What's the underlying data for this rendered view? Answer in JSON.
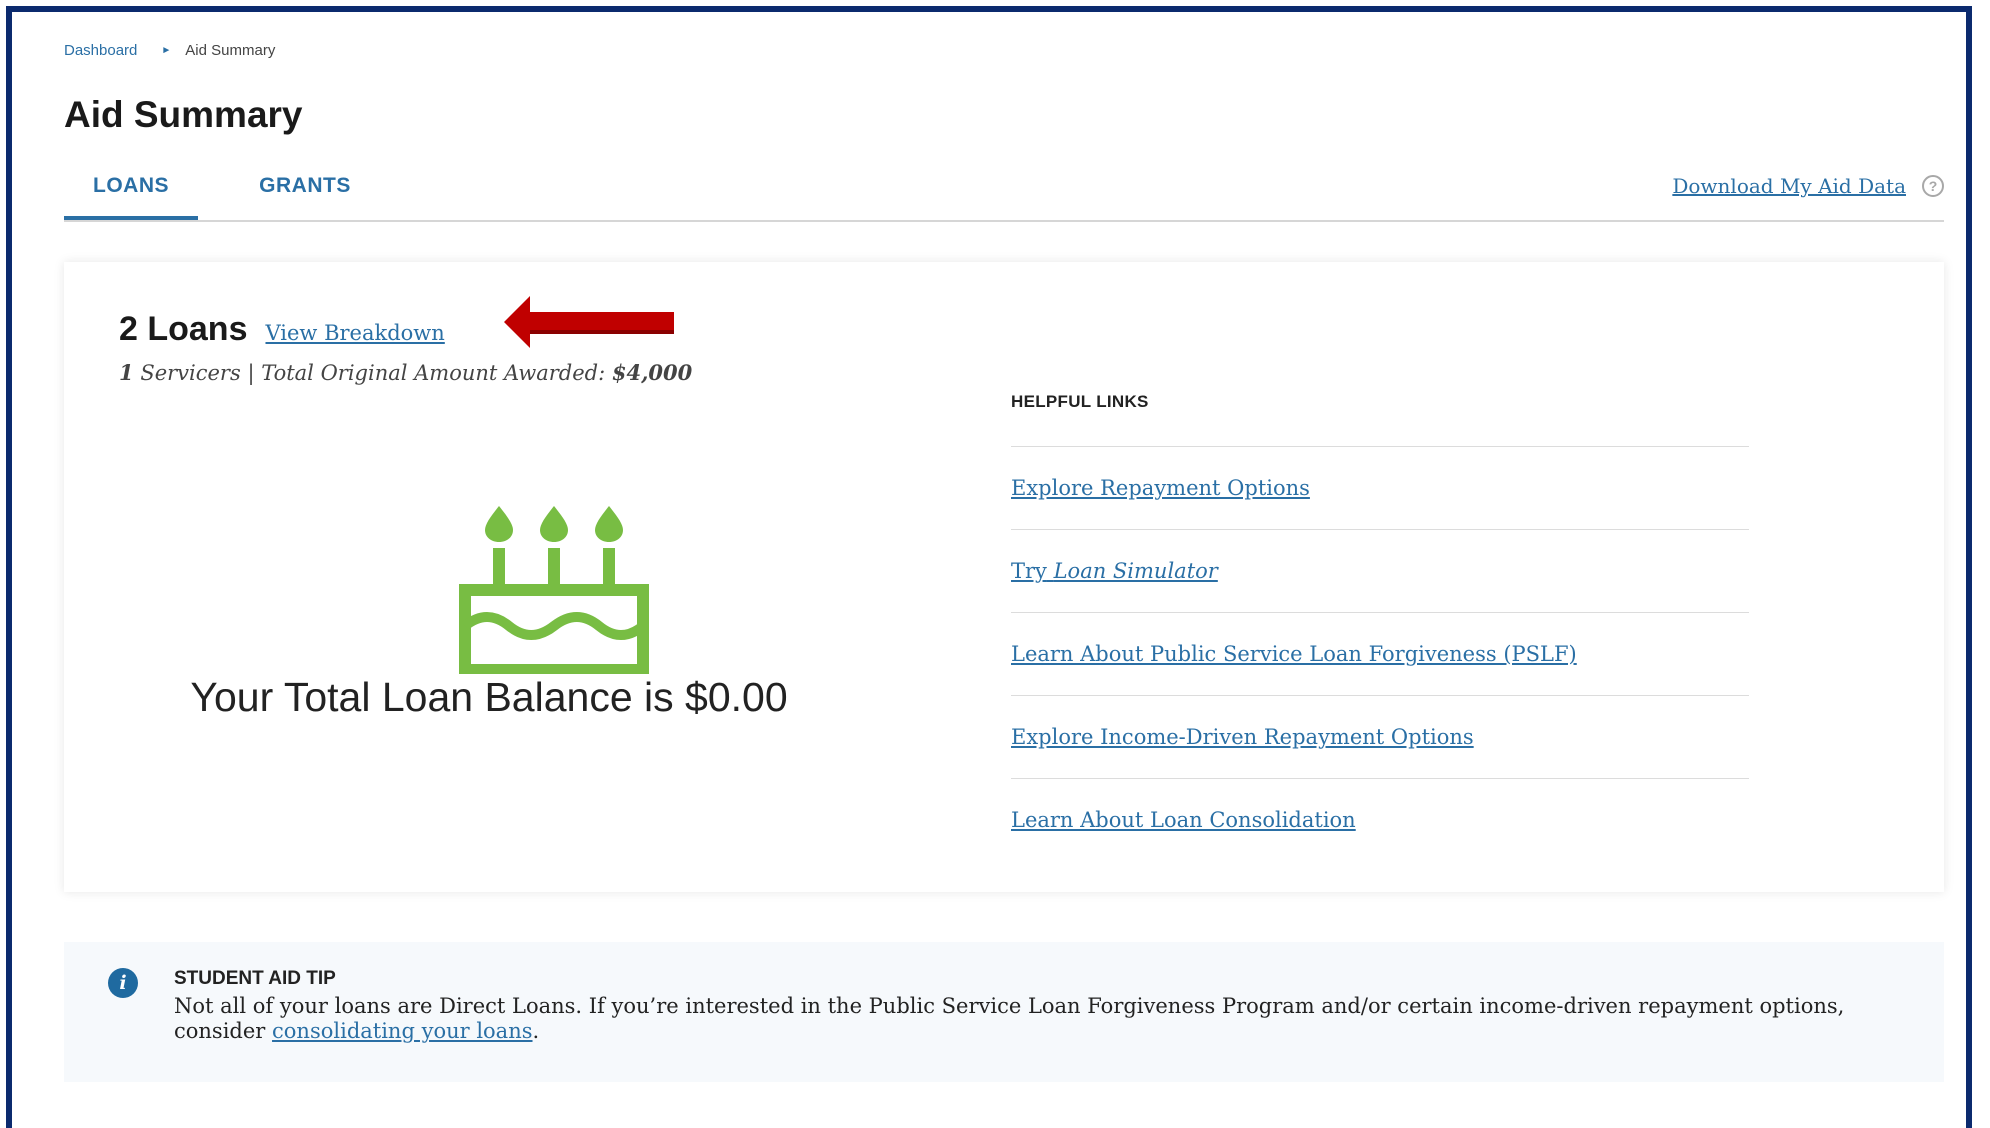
{
  "breadcrumb": {
    "home": "Dashboard",
    "separator": "►",
    "current": "Aid Summary"
  },
  "page": {
    "title": "Aid Summary"
  },
  "tabs": [
    {
      "label": "LOANS",
      "active": true
    },
    {
      "label": "GRANTS",
      "active": false
    }
  ],
  "download": {
    "label": "Download My Aid Data",
    "help_icon": "question-circle-icon",
    "help_glyph": "?"
  },
  "loans": {
    "count_label": "2 Loans",
    "view_breakdown": "View Breakdown",
    "servicers_count": "1",
    "servicers_label": "Servicers",
    "divider": "|",
    "total_label": "Total Original Amount Awarded:",
    "total_value": "$4,000",
    "balance_text": "Your Total Loan Balance is $0.00",
    "cake_icon": "birthday-cake-icon",
    "arrow_icon": "red-arrow-icon"
  },
  "helpful_links": {
    "title": "HELPFUL LINKS",
    "items": [
      {
        "label": "Explore Repayment Options"
      },
      {
        "label": "Try",
        "label_em": "Loan Simulator"
      },
      {
        "label": "Learn About Public Service Loan Forgiveness (PSLF)"
      },
      {
        "label": "Explore Income-Driven Repayment Options"
      },
      {
        "label": "Learn About Loan Consolidation"
      }
    ]
  },
  "tip": {
    "icon": "info-icon",
    "icon_glyph": "i",
    "title": "STUDENT AID TIP",
    "text_before": "Not all of your loans are Direct Loans. If you’re interested in the Public Service Loan Forgiveness Program and/or certain income-driven repayment options, consider",
    "link": "consolidating your loans",
    "text_after": "."
  },
  "colors": {
    "link": "#2a6fa5",
    "frame": "#0b2a6e",
    "cake": "#78bd43",
    "arrow": "#c00000",
    "info": "#1f6aa0"
  }
}
